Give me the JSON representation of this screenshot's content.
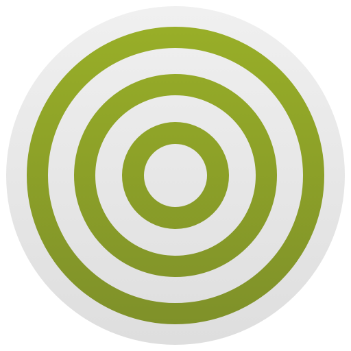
{
  "icon": {
    "name": "concentric-rings-icon",
    "ring_count": 3,
    "colors": {
      "background": "#ffffff",
      "disc_light": "#f0f0f0",
      "disc_dark": "#dedede",
      "ring_top": "#98ae28",
      "ring_bottom": "#7f9129"
    }
  }
}
